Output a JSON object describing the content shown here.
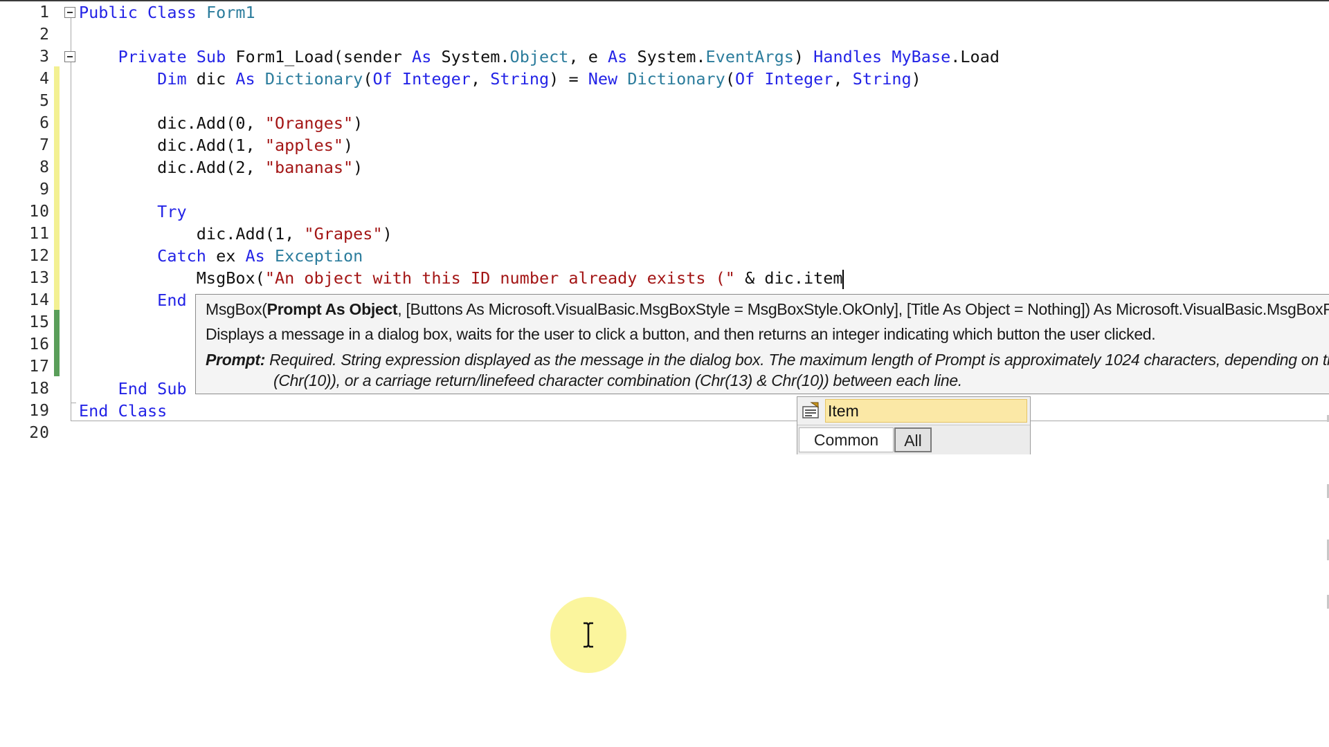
{
  "editor": {
    "line_numbers": [
      "1",
      "2",
      "3",
      "4",
      "5",
      "6",
      "7",
      "8",
      "9",
      "10",
      "11",
      "12",
      "13",
      "14",
      "15",
      "16",
      "17",
      "18",
      "19",
      "20"
    ],
    "code_lines": [
      [
        {
          "t": "Public Class ",
          "c": "kw"
        },
        {
          "t": "Form1",
          "c": "ty"
        }
      ],
      [],
      [
        {
          "t": "    Private Sub ",
          "c": "kw"
        },
        {
          "t": "Form1_Load(sender ",
          "c": "id"
        },
        {
          "t": "As ",
          "c": "kw"
        },
        {
          "t": "System.",
          "c": "id"
        },
        {
          "t": "Object",
          "c": "ty"
        },
        {
          "t": ", e ",
          "c": "id"
        },
        {
          "t": "As ",
          "c": "kw"
        },
        {
          "t": "System.",
          "c": "id"
        },
        {
          "t": "EventArgs",
          "c": "ty"
        },
        {
          "t": ") ",
          "c": "id"
        },
        {
          "t": "Handles ",
          "c": "kw"
        },
        {
          "t": "MyBase",
          "c": "kw"
        },
        {
          "t": ".Load",
          "c": "id"
        }
      ],
      [
        {
          "t": "        Dim ",
          "c": "kw"
        },
        {
          "t": "dic ",
          "c": "id"
        },
        {
          "t": "As ",
          "c": "kw"
        },
        {
          "t": "Dictionary",
          "c": "ty"
        },
        {
          "t": "(",
          "c": "id"
        },
        {
          "t": "Of ",
          "c": "kw"
        },
        {
          "t": "Integer",
          "c": "kw"
        },
        {
          "t": ", ",
          "c": "id"
        },
        {
          "t": "String",
          "c": "kw"
        },
        {
          "t": ") = ",
          "c": "id"
        },
        {
          "t": "New ",
          "c": "kw"
        },
        {
          "t": "Dictionary",
          "c": "ty"
        },
        {
          "t": "(",
          "c": "id"
        },
        {
          "t": "Of ",
          "c": "kw"
        },
        {
          "t": "Integer",
          "c": "kw"
        },
        {
          "t": ", ",
          "c": "id"
        },
        {
          "t": "String",
          "c": "kw"
        },
        {
          "t": ")",
          "c": "id"
        }
      ],
      [],
      [
        {
          "t": "        dic.Add(0, ",
          "c": "id"
        },
        {
          "t": "\"Oranges\"",
          "c": "str"
        },
        {
          "t": ")",
          "c": "id"
        }
      ],
      [
        {
          "t": "        dic.Add(1, ",
          "c": "id"
        },
        {
          "t": "\"apples\"",
          "c": "str"
        },
        {
          "t": ")",
          "c": "id"
        }
      ],
      [
        {
          "t": "        dic.Add(2, ",
          "c": "id"
        },
        {
          "t": "\"bananas\"",
          "c": "str"
        },
        {
          "t": ")",
          "c": "id"
        }
      ],
      [],
      [
        {
          "t": "        Try",
          "c": "kw"
        }
      ],
      [
        {
          "t": "            dic.Add(1, ",
          "c": "id"
        },
        {
          "t": "\"Grapes\"",
          "c": "str"
        },
        {
          "t": ")",
          "c": "id"
        }
      ],
      [
        {
          "t": "        Catch ",
          "c": "kw"
        },
        {
          "t": "ex ",
          "c": "id"
        },
        {
          "t": "As ",
          "c": "kw"
        },
        {
          "t": "Exception",
          "c": "ty"
        }
      ],
      [
        {
          "t": "            MsgBox(",
          "c": "id"
        },
        {
          "t": "\"An object with this ID number already exists (\"",
          "c": "str"
        },
        {
          "t": " & dic.item",
          "c": "id"
        }
      ],
      [
        {
          "t": "        End",
          "c": "kw"
        }
      ],
      [],
      [],
      [],
      [
        {
          "t": "    End Sub",
          "c": "kw"
        }
      ],
      [
        {
          "t": "End Class",
          "c": "kw"
        }
      ],
      []
    ]
  },
  "tooltip": {
    "sig_prefix": "MsgBox(",
    "sig_param": "Prompt As Object",
    "sig_rest": ", [Buttons As Microsoft.VisualBasic.MsgBoxStyle = MsgBoxStyle.OkOnly], [Title As Object = Nothing]) As Microsoft.VisualBasic.MsgBoxResult",
    "description": "Displays a message in a dialog box, waits for the user to click a button, and then returns an integer indicating which button the user clicked.",
    "param_name": "Prompt:",
    "param_text": " Required. String expression displayed as the message in the dialog box. The maximum length of Prompt is approximately 1024 characters, depending on the width of the characters used. If Prompt consists of more than one line, you can separate the lines using a carriage return character (Chr(13)), a linefeed character",
    "param_text2": "(Chr(10)), or a carriage return/linefeed character combination (Chr(13) & Chr(10)) between each line."
  },
  "completion": {
    "selected_item": "Item",
    "item_icon": "property-icon",
    "tabs": [
      "Common",
      "All"
    ],
    "active_tab": "All"
  },
  "cursor": {
    "icon": "ibeam-cursor-icon",
    "highlight_color": "#fbf59d"
  }
}
